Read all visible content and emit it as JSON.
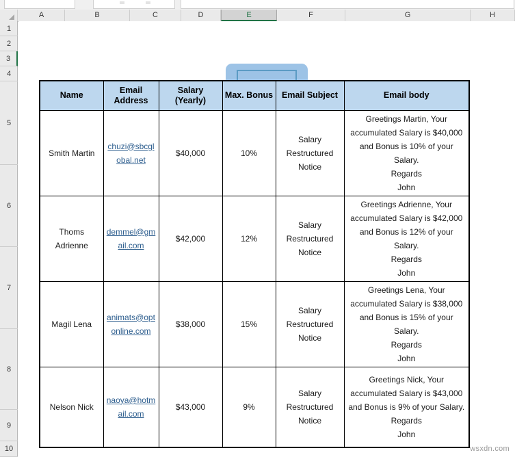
{
  "app": {
    "watermark": "wsxdn.com"
  },
  "grid": {
    "column_headers": [
      "A",
      "B",
      "C",
      "D",
      "E",
      "F",
      "G",
      "H"
    ],
    "selected_column": "E",
    "row_headers": [
      "1",
      "2",
      "3",
      "4",
      "5",
      "6",
      "7",
      "8",
      "9",
      "10"
    ],
    "active_row": "3"
  },
  "shape": {
    "name": "rounded-rectangle-shape",
    "fill_color": "#9DC3E6",
    "outline_color": "#5B9BC4",
    "handle_color": "#3F7FA6"
  },
  "table": {
    "headers": [
      "Name",
      "Email Address",
      "Salary (Yearly)",
      "Max. Bonus",
      "Email Subject",
      "Email body"
    ],
    "header_fill": "#BDD7EE",
    "rows": [
      {
        "name": "Smith Martin",
        "email": "chuzi@sbcglobal.net",
        "salary": "$40,000",
        "bonus": "10%",
        "subject": "Salary Restructured Notice",
        "body": "Greetings Martin, Your accumulated Salary is $40,000 and Bonus is 10% of your Salary.\nRegards\nJohn"
      },
      {
        "name": "Thoms Adrienne",
        "email": "demmel@gmail.com",
        "salary": "$42,000",
        "bonus": "12%",
        "subject": "Salary Restructured Notice",
        "body": "Greetings Adrienne, Your accumulated Salary is $42,000 and Bonus is 12% of your Salary.\nRegards\nJohn"
      },
      {
        "name": "Magil Lena",
        "email": "animats@optonline.com",
        "salary": "$38,000",
        "bonus": "15%",
        "subject": "Salary Restructured Notice",
        "body": "Greetings Lena, Your accumulated Salary is $38,000 and Bonus is 15% of your Salary.\nRegards\nJohn"
      },
      {
        "name": "Nelson  Nick",
        "email": "naoya@hotmail.com",
        "salary": "$43,000",
        "bonus": "9%",
        "subject": "Salary Restructured Notice",
        "body": "Greetings Nick, Your accumulated Salary is $43,000 and Bonus is 9% of your Salary.\nRegards\nJohn"
      }
    ]
  }
}
